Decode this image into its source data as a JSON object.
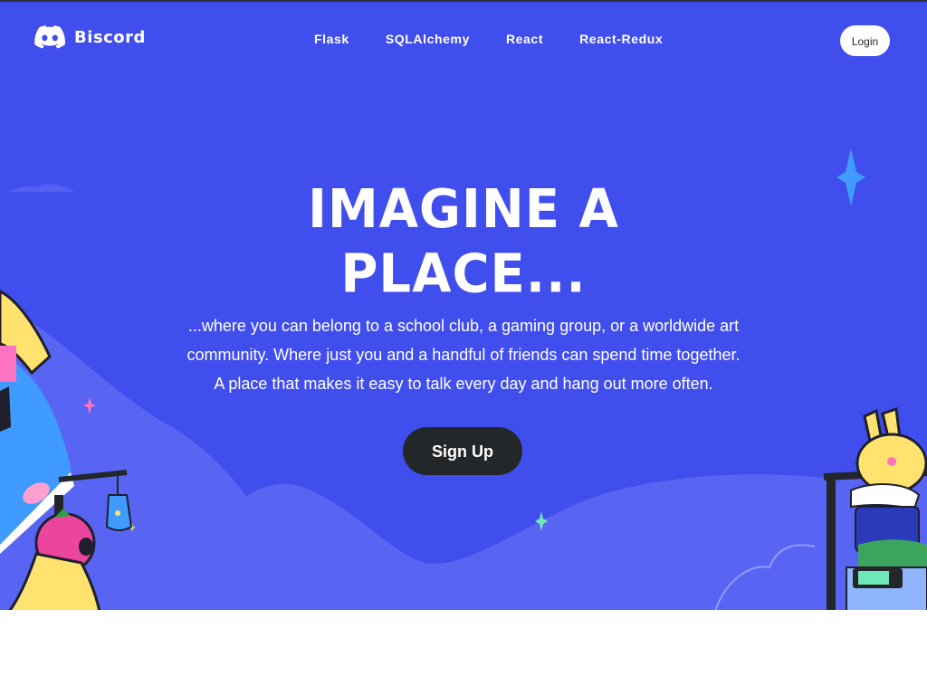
{
  "nav": {
    "brand": "Biscord",
    "links": [
      "Flask",
      "SQLAlchemy",
      "React",
      "React-Redux"
    ],
    "login_label": "Login"
  },
  "hero": {
    "headline_line1": "IMAGINE A",
    "headline_line2": "PLACE...",
    "tagline": "...where you can belong to a school club, a gaming group, or a worldwide art community. Where just you and a handful of friends can spend time together. A place that makes it easy to talk every day and hang out more often.",
    "signup_label": "Sign Up"
  },
  "colors": {
    "hero_background": "#404eed",
    "hill": "#5865f2",
    "button_dark": "#23272a",
    "white": "#ffffff"
  },
  "icons": {
    "brand": "discord-logo-icon",
    "sparkles": [
      "sparkle-icon"
    ]
  }
}
